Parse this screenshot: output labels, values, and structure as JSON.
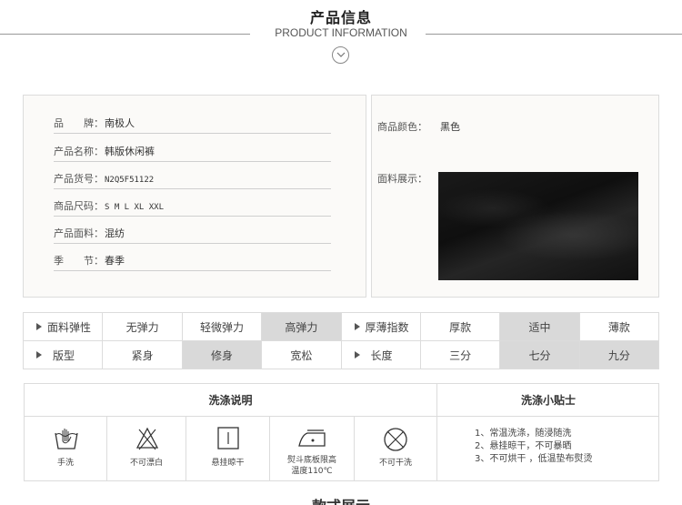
{
  "header": {
    "title_cn": "产品信息",
    "title_en": "PRODUCT INFORMATION"
  },
  "info": {
    "rows": [
      {
        "key": "品　　牌：",
        "value": "南极人"
      },
      {
        "key": "产品名称：",
        "value": "韩版休闲裤"
      },
      {
        "key": "产品货号：",
        "value": "N2Q5F51122"
      },
      {
        "key": "商品尺码：",
        "value": "S M L XL XXL"
      },
      {
        "key": "产品面料：",
        "value": "混纺"
      },
      {
        "key": "季　　节：",
        "value": "春季"
      }
    ],
    "color_label": "商品颜色：",
    "color_value": "黑色",
    "fabric_label": "面料展示："
  },
  "attributes": {
    "row1": {
      "label1": "面料弹性",
      "options1": [
        "无弹力",
        "轻微弹力",
        "高弹力"
      ],
      "selected1": 2,
      "label2": "厚薄指数",
      "options2": [
        "厚款",
        "适中",
        "薄款"
      ],
      "selected2": 1
    },
    "row2": {
      "label1": "版型",
      "options1": [
        "紧身",
        "修身",
        "宽松"
      ],
      "selected1": 1,
      "label2": "长度",
      "options2": [
        "三分",
        "七分",
        "九分"
      ],
      "selected2": [
        1,
        2
      ]
    }
  },
  "wash": {
    "header_left": "洗涤说明",
    "header_right": "洗涤小贴士",
    "icons": [
      {
        "icon": "hand-wash-icon",
        "caption": "手洗"
      },
      {
        "icon": "no-bleach-icon",
        "caption": "不可漂白"
      },
      {
        "icon": "hang-dry-icon",
        "caption": "悬挂晾干"
      },
      {
        "icon": "iron-icon",
        "caption_line1": "熨斗底板限高",
        "caption_line2": "温度110℃"
      },
      {
        "icon": "no-dry-clean-icon",
        "caption": "不可干洗"
      }
    ],
    "tips": [
      "1、常温洗涤，随浸随洗",
      "2、悬挂晾干，不可暴晒",
      "3、不可烘干 ，低温垫布熨烫"
    ]
  },
  "next_section": "款式展示"
}
